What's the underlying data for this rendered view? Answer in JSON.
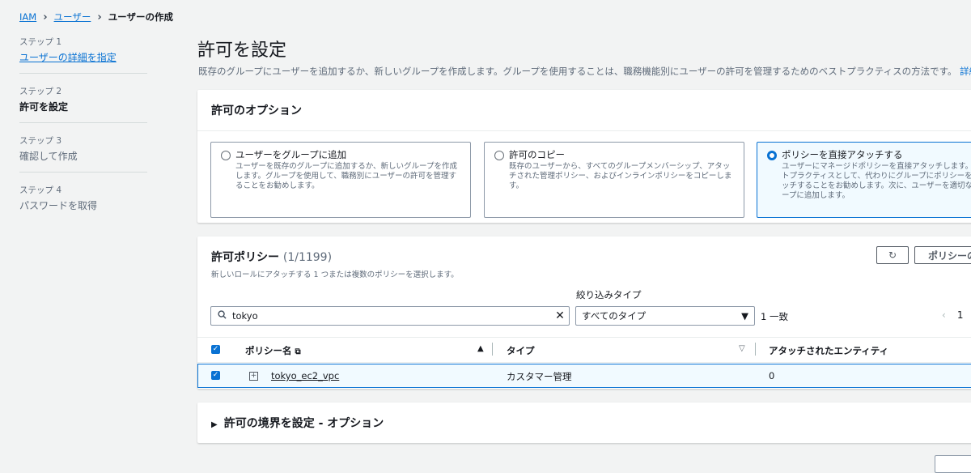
{
  "breadcrumb": {
    "items": [
      "IAM",
      "ユーザー"
    ],
    "current": "ユーザーの作成"
  },
  "steps": [
    {
      "num": "ステップ 1",
      "label": "ユーザーの詳細を指定"
    },
    {
      "num": "ステップ 2",
      "label": "許可を設定"
    },
    {
      "num": "ステップ 3",
      "label": "確認して作成"
    },
    {
      "num": "ステップ 4",
      "label": "パスワードを取得"
    }
  ],
  "header": {
    "title": "許可を設定",
    "description": "既存のグループにユーザーを追加するか、新しいグループを作成します。グループを使用することは、職務機能別にユーザーの許可を管理するためのベストプラクティスの方法です。",
    "info_link": "詳細はこち"
  },
  "permission_options": {
    "title": "許可のオプション",
    "options": [
      {
        "title": "ユーザーをグループに追加",
        "desc": "ユーザーを既存のグループに追加するか、新しいグループを作成します。グループを使用して、職務別にユーザーの許可を管理することをお勧めします。",
        "selected": false
      },
      {
        "title": "許可のコピー",
        "desc": "既存のユーザーから、すべてのグループメンバーシップ、アタッチされた管理ポリシー、およびインラインポリシーをコピーします。",
        "selected": false
      },
      {
        "title": "ポリシーを直接アタッチする",
        "desc": "ユーザーにマネージドポリシーを直接アタッチします。ベストプラクティスとして、代わりにグループにポリシーをアタッチすることをお勧めします。次に、ユーザーを適切なグループに追加します。",
        "selected": true
      }
    ]
  },
  "policies": {
    "title": "許可ポリシー",
    "count": "(1/1199)",
    "description": "新しいロールにアタッチする 1 つまたは複数のポリシーを選択します。",
    "refresh_icon": "refresh-icon",
    "create_button": "ポリシーの作成",
    "filter_label": "絞り込みタイプ",
    "search_value": "tokyo",
    "type_select": "すべてのタイプ",
    "match_count": "1 一致",
    "page_number": "1",
    "columns": [
      "ポリシー名",
      "タイプ",
      "アタッチされたエンティティ"
    ],
    "rows": [
      {
        "name": "tokyo_ec2_vpc",
        "type": "カスタマー管理",
        "entities": "0",
        "checked": true
      }
    ]
  },
  "boundary": {
    "title": "許可の境界を設定 - オプション"
  },
  "colors": {
    "accent": "#0972d3",
    "background": "#f2f3f3",
    "selected_bg": "#f1faff"
  }
}
